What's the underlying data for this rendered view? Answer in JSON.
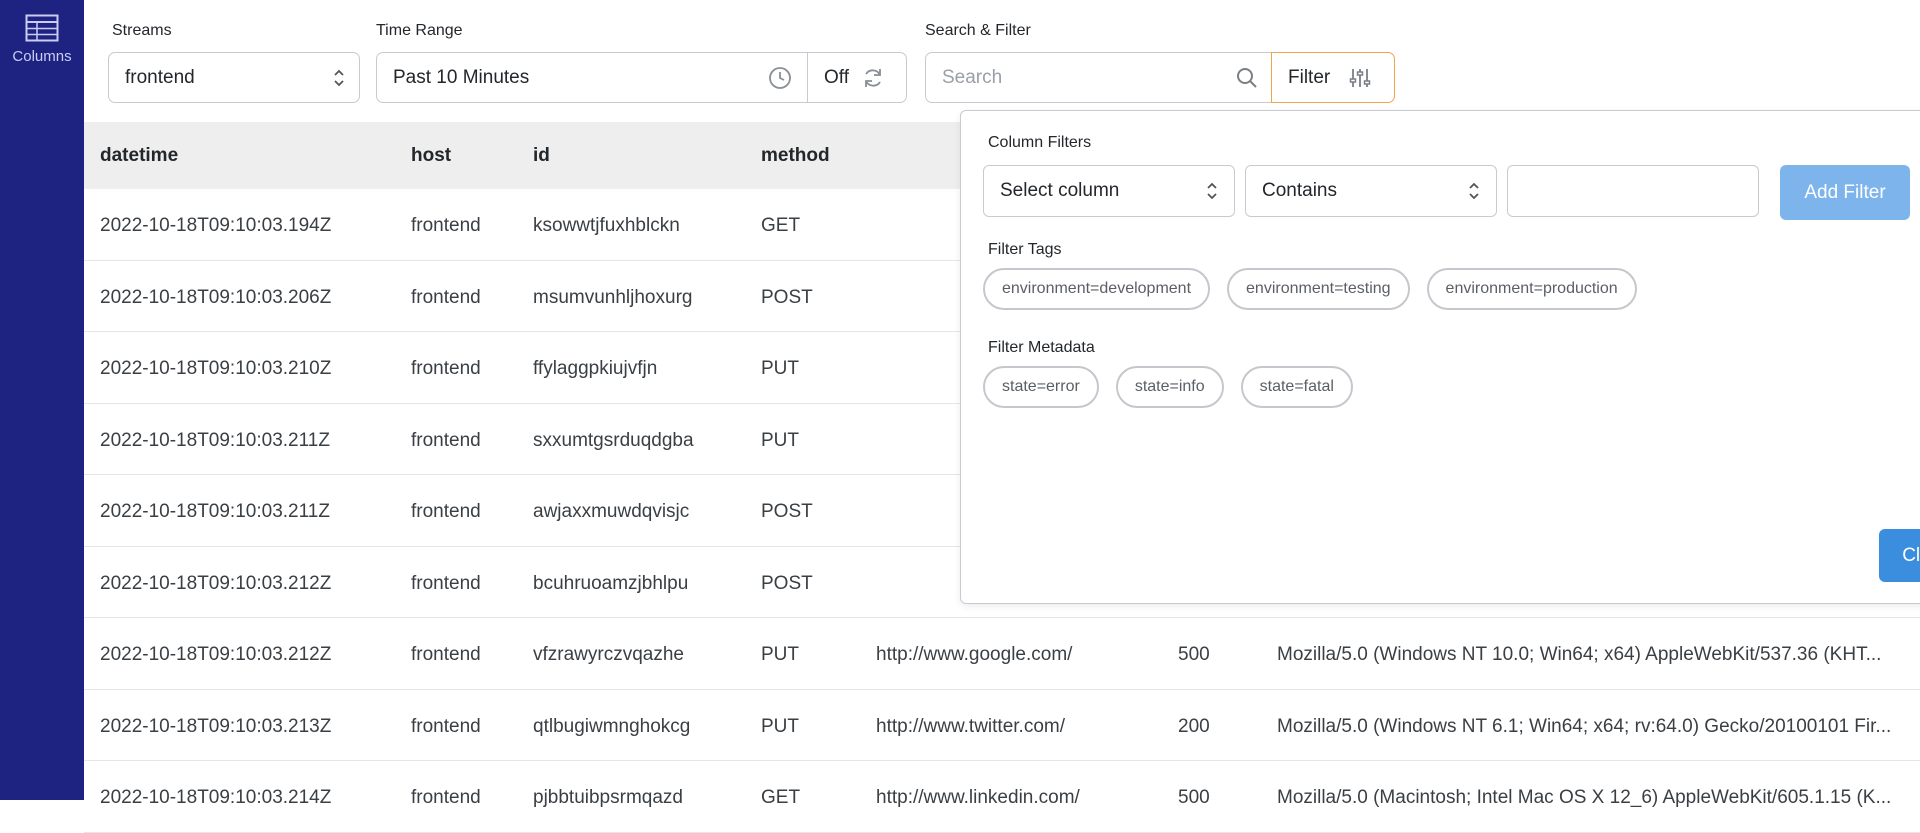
{
  "sidebar": {
    "columns_label": "Columns"
  },
  "controls": {
    "streams_label": "Streams",
    "stream_value": "frontend",
    "time_range_label": "Time Range",
    "time_range_value": "Past 10 Minutes",
    "refresh_value": "Off",
    "search_filter_label": "Search & Filter",
    "search_placeholder": "Search",
    "filter_label": "Filter"
  },
  "table": {
    "headers": [
      "datetime",
      "host",
      "id",
      "method"
    ],
    "rows": [
      {
        "datetime": "2022-10-18T09:10:03.194Z",
        "host": "frontend",
        "id": "ksowwtjfuxhblckn",
        "method": "GET",
        "url": "",
        "code": "",
        "ua": ""
      },
      {
        "datetime": "2022-10-18T09:10:03.206Z",
        "host": "frontend",
        "id": "msumvunhljhoxurg",
        "method": "POST",
        "url": "",
        "code": "",
        "ua": ""
      },
      {
        "datetime": "2022-10-18T09:10:03.210Z",
        "host": "frontend",
        "id": "ffylaggpkiujvfjn",
        "method": "PUT",
        "url": "",
        "code": "",
        "ua": ""
      },
      {
        "datetime": "2022-10-18T09:10:03.211Z",
        "host": "frontend",
        "id": "sxxumtgsrduqdgba",
        "method": "PUT",
        "url": "",
        "code": "",
        "ua": ""
      },
      {
        "datetime": "2022-10-18T09:10:03.211Z",
        "host": "frontend",
        "id": "awjaxxmuwdqvisjc",
        "method": "POST",
        "url": "",
        "code": "",
        "ua": ""
      },
      {
        "datetime": "2022-10-18T09:10:03.212Z",
        "host": "frontend",
        "id": "bcuhruoamzjbhlpu",
        "method": "POST",
        "url": "",
        "code": "",
        "ua": ""
      },
      {
        "datetime": "2022-10-18T09:10:03.212Z",
        "host": "frontend",
        "id": "vfzrawyrczvqazhe",
        "method": "PUT",
        "url": "http://www.google.com/",
        "code": "500",
        "ua": "Mozilla/5.0 (Windows NT 10.0; Win64; x64) AppleWebKit/537.36 (KHT..."
      },
      {
        "datetime": "2022-10-18T09:10:03.213Z",
        "host": "frontend",
        "id": "qtlbugiwmnghokcg",
        "method": "PUT",
        "url": "http://www.twitter.com/",
        "code": "200",
        "ua": "Mozilla/5.0 (Windows NT 6.1; Win64; x64; rv:64.0) Gecko/20100101 Fir..."
      },
      {
        "datetime": "2022-10-18T09:10:03.214Z",
        "host": "frontend",
        "id": "pjbbtuibpsrmqazd",
        "method": "GET",
        "url": "http://www.linkedin.com/",
        "code": "500",
        "ua": "Mozilla/5.0 (Macintosh; Intel Mac OS X 12_6) AppleWebKit/605.1.15 (K..."
      }
    ]
  },
  "filter_panel": {
    "column_filters_label": "Column Filters",
    "select_column": "Select column",
    "operator": "Contains",
    "add_filter": "Add Filter",
    "filter_tags_label": "Filter Tags",
    "tags": [
      "environment=development",
      "environment=testing",
      "environment=production"
    ],
    "filter_metadata_label": "Filter Metadata",
    "metadata": [
      "state=error",
      "state=info",
      "state=fatal"
    ],
    "close": "Close"
  }
}
